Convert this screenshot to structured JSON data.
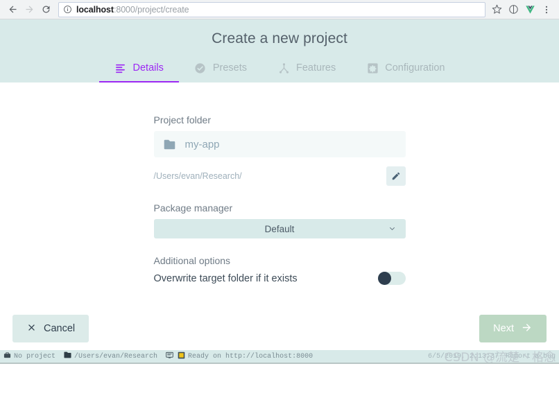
{
  "browser": {
    "back_icon": "arrow-left-icon",
    "forward_icon": "arrow-right-icon",
    "reload_icon": "reload-icon",
    "url_info_icon": "info-circle-icon",
    "url_host": "localhost",
    "url_rest": ":8000/project/create",
    "bookmark_icon": "star-icon",
    "info_icon": "info-circle-icon",
    "extension_icon": "vue-devtools-icon",
    "menu_icon": "kebab-menu-icon"
  },
  "header": {
    "title": "Create a new project",
    "tabs": [
      {
        "label": "Details",
        "icon": "list-lines-icon",
        "active": true
      },
      {
        "label": "Presets",
        "icon": "check-circle-icon",
        "active": false
      },
      {
        "label": "Features",
        "icon": "sitemap-icon",
        "active": false
      },
      {
        "label": "Configuration",
        "icon": "gear-square-icon",
        "active": false
      }
    ]
  },
  "form": {
    "project_folder_label": "Project folder",
    "folder_icon": "folder-icon",
    "folder_value": "my-app",
    "folder_placeholder": "my-app",
    "path_value": "/Users/evan/Research/",
    "edit_icon": "pencil-icon",
    "package_manager_label": "Package manager",
    "package_manager_value": "Default",
    "package_manager_options": [
      "Default"
    ],
    "chevron_icon": "chevron-down-icon",
    "additional_options_label": "Additional options",
    "overwrite_label": "Overwrite target folder if it exists",
    "overwrite_enabled": false
  },
  "actions": {
    "cancel_label": "Cancel",
    "cancel_icon": "close-x-icon",
    "next_label": "Next",
    "next_icon": "arrow-right-icon"
  },
  "status": {
    "project_icon": "briefcase-icon",
    "project_text": "No project",
    "folder_icon": "folder-icon",
    "folder_text": "/Users/evan/Research",
    "terminal_icon": "terminal-icon",
    "app_icon": "app-square-icon",
    "ready_text": "Ready on http://localhost:8000",
    "timestamp": "6/5/2019, 2:13:37",
    "report_text": "Report a bug",
    "watermark": "CSDN @流楚丶格念"
  },
  "colors": {
    "header_bg": "#d8eae9",
    "accent_purple": "#9c27f3",
    "next_green": "#bcd8c3",
    "cancel_bg": "#dcebe9",
    "toggle_knob": "#2e3e4e"
  }
}
